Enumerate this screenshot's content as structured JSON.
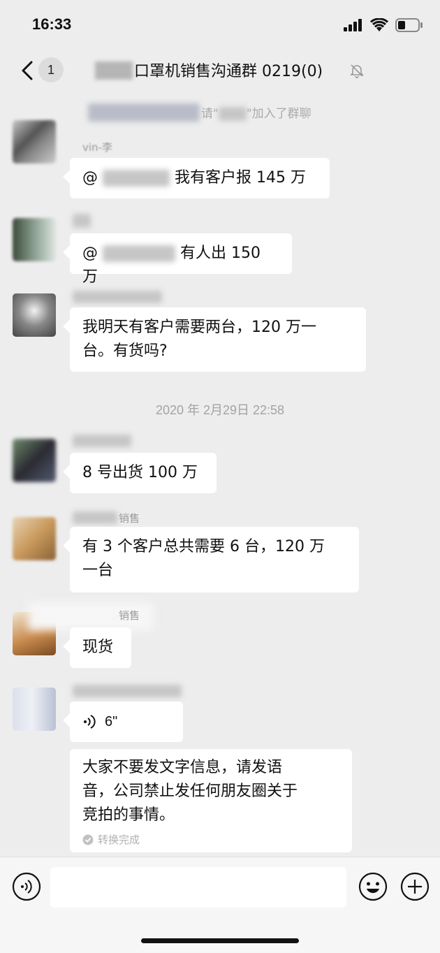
{
  "status": {
    "time": "16:33"
  },
  "nav": {
    "unread": "1",
    "title": "口罩机销售沟通群 0219(0)"
  },
  "messages": {
    "system_join": {
      "prefix": "请\"",
      "suffix": "\"加入了群聊"
    },
    "m1": {
      "sender": "vin-李",
      "text": "我有客户报 145 万",
      "mention": "@"
    },
    "m2": {
      "text": "有人出 150 万",
      "mention": "@"
    },
    "m3": {
      "line1": "我明天有客户需要两台，120 万一",
      "line2": "台。有货吗?"
    },
    "timestamp": "2020 年 2月29日 22:58",
    "m4": {
      "text": "8 号出货 100 万"
    },
    "m5": {
      "sender": "销售",
      "line1": "有 3 个客户总共需要 6 台，120 万",
      "line2": "一台"
    },
    "m6": {
      "sender": "销售",
      "text": "现货"
    },
    "m7": {
      "voice_duration": "6\""
    },
    "m8": {
      "line1": "大家不要发文字信息，请发语",
      "line2": "音，公司禁止发任何朋友圈关于",
      "line3": "竞拍的事情。",
      "status": "转换完成"
    }
  },
  "icons": {
    "back": "chevron-left-icon",
    "mute": "bell-off-icon",
    "voice": "voice-input-icon",
    "emoji": "emoji-icon",
    "plus": "plus-icon",
    "check": "check-circle-icon",
    "audio": "audio-wave-icon"
  }
}
